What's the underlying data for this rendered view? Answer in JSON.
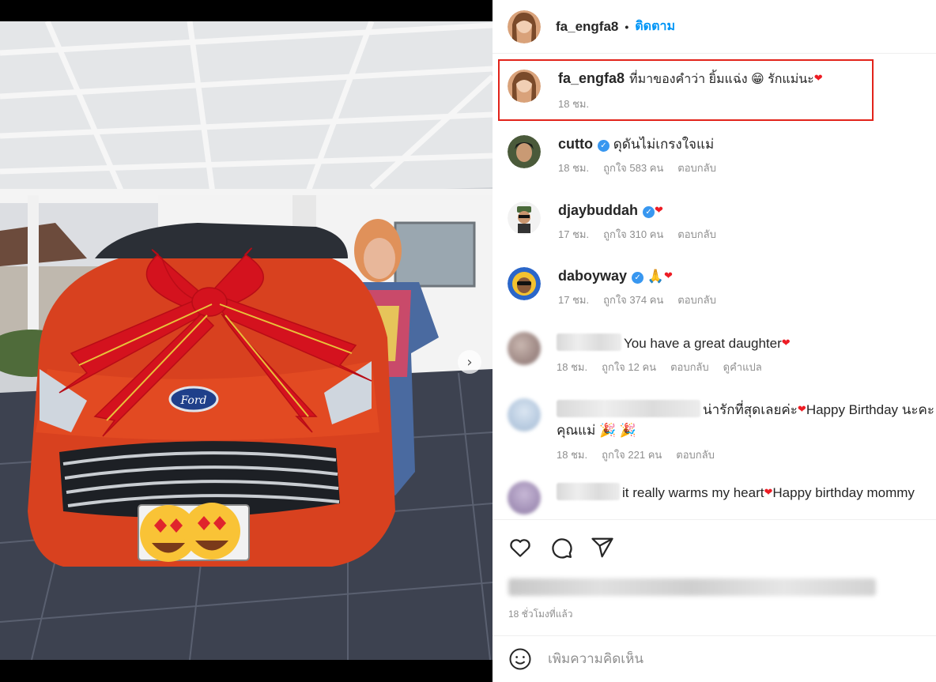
{
  "post": {
    "username": "fa_engfa8",
    "separator": "•",
    "follow_label": "ติดตาม",
    "photo_slide_count": 2,
    "photo_active_slide": 1,
    "photo_next_icon": "chevron-right-icon",
    "photo_next_glyph": "›"
  },
  "caption": {
    "username": "fa_engfa8",
    "text": "ที่มาของคำว่า ยิ้มแฉ่ง 😁 รักแม่นะ",
    "heart": "❤",
    "time": "18 ชม."
  },
  "comments": [
    {
      "username": "cutto",
      "verified": true,
      "text": "ดุดันไม่เกรงใจแม่",
      "time": "18 ชม.",
      "likes": "ถูกใจ 583 คน",
      "reply": "ตอบกลับ"
    },
    {
      "username": "djaybuddah",
      "verified": true,
      "text": "",
      "heart": "❤",
      "time": "17 ชม.",
      "likes": "ถูกใจ 310 คน",
      "reply": "ตอบกลับ"
    },
    {
      "username": "daboyway",
      "verified": true,
      "text": "🙏",
      "heart": "❤",
      "time": "17 ชม.",
      "likes": "ถูกใจ 374 คน",
      "reply": "ตอบกลับ"
    },
    {
      "username": "",
      "text": "You have a great daughter",
      "heart": "❤",
      "time": "18 ชม.",
      "likes": "ถูกใจ 12 คน",
      "reply": "ตอบกลับ",
      "translate": "ดูคำแปล"
    },
    {
      "username": "",
      "text": "น่ารักที่สุดเลยค่ะ",
      "text_after_heart": "Happy Birthday นะคะ",
      "text_line2": "คุณแม่ 🎉 🎉",
      "heart": "❤",
      "time": "18 ชม.",
      "likes": "ถูกใจ 221 คน",
      "reply": "ตอบกลับ"
    },
    {
      "username": "",
      "text": "it really warms my heart",
      "text_after_heart": "Happy birthday mommy",
      "heart": "❤"
    }
  ],
  "actions": {
    "like_icon": "heart-outline-icon",
    "comment_icon": "comment-bubble-icon",
    "share_icon": "paper-plane-icon",
    "time_ago": "18 ชั่วโมงที่แล้ว"
  },
  "add_comment": {
    "emoji_icon": "smiley-icon",
    "placeholder": "เพิ่มความคิดเห็น"
  },
  "colors": {
    "follow_blue": "#0095f6",
    "verified_blue": "#3897f0",
    "highlight_red": "#e2231a",
    "heart_red": "#ed1c24",
    "meta_gray": "#8e8e8e"
  }
}
